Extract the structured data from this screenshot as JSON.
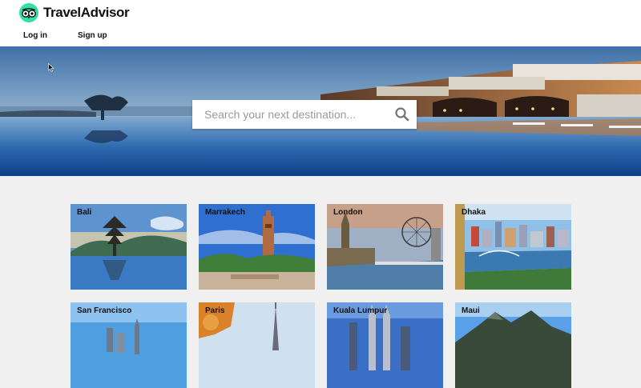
{
  "header": {
    "brand": "TravelAdvisor",
    "login": "Log in",
    "signup": "Sign up"
  },
  "search": {
    "placeholder": "Search your next destination..."
  },
  "destinations": [
    {
      "name": "Bali"
    },
    {
      "name": "Marrakech"
    },
    {
      "name": "London"
    },
    {
      "name": "Dhaka"
    },
    {
      "name": "San Francisco"
    },
    {
      "name": "Paris"
    },
    {
      "name": "Kuala Lumpur"
    },
    {
      "name": "Maui"
    }
  ],
  "colors": {
    "brand": "#34e0a1",
    "background": "#f1f0f1"
  }
}
